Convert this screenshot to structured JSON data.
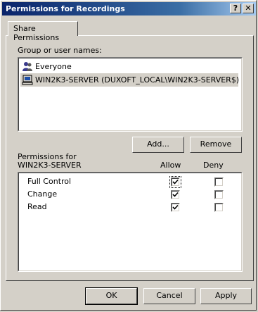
{
  "window": {
    "title": "Permissions for Recordings",
    "help_glyph": "?",
    "close_glyph": "✕"
  },
  "tabs": [
    {
      "label": "Share Permissions"
    }
  ],
  "group_section": {
    "label": "Group or user names:",
    "items": [
      {
        "label": "Everyone",
        "icon": "users-group-icon"
      },
      {
        "label": "WIN2K3-SERVER (DUXOFT_LOCAL\\WIN2K3-SERVER$)",
        "icon": "computer-icon"
      }
    ],
    "add_label": "Add...",
    "remove_label": "Remove"
  },
  "permissions": {
    "title_line1": "Permissions for",
    "title_line2": "WIN2K3-SERVER",
    "allow_header": "Allow",
    "deny_header": "Deny",
    "rows": [
      {
        "name": "Full Control",
        "allow": true,
        "deny": false
      },
      {
        "name": "Change",
        "allow": true,
        "deny": false
      },
      {
        "name": "Read",
        "allow": true,
        "deny": false
      }
    ]
  },
  "footer": {
    "ok_label": "OK",
    "cancel_label": "Cancel",
    "apply_label": "Apply"
  },
  "colors": {
    "title_gradient_start": "#0a246a",
    "title_gradient_end": "#a6caf0",
    "face": "#d4d0c8"
  }
}
